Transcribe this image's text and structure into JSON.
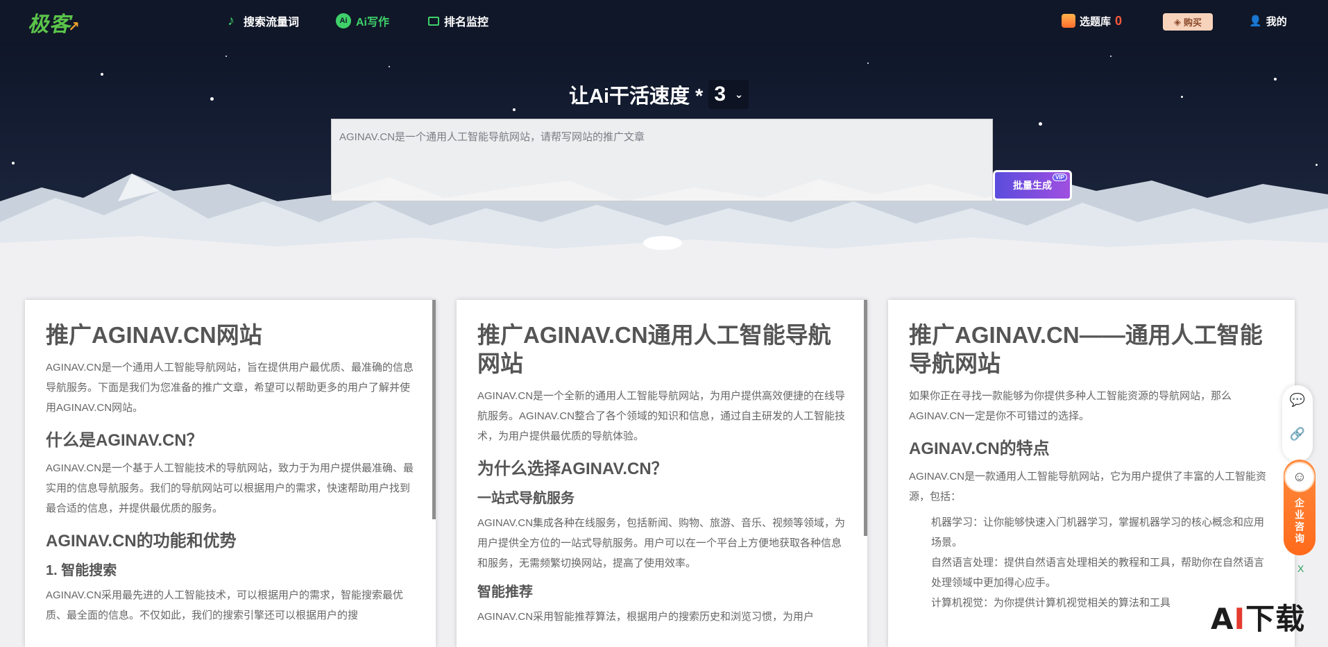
{
  "nav": {
    "logo": "极客",
    "items": [
      {
        "label": "搜索流量词",
        "icon": "tiktok-icon"
      },
      {
        "label": "Ai写作",
        "icon": "ai-icon",
        "icon_text": "Ai"
      },
      {
        "label": "排名监控",
        "icon": "monitor-icon"
      }
    ],
    "library_label": "选题库",
    "library_count": "0",
    "buy_label": "购买",
    "user_label": "我的"
  },
  "hero": {
    "title": "让Ai干活速度 *",
    "speed_value": "3",
    "prompt_text": "AGINAV.CN是一个通用人工智能导航网站，请帮写网站的推广文章",
    "generate_label": "批量生成",
    "vip_tag": "VIP"
  },
  "cards": [
    {
      "title": "推广AGINAV.CN网站",
      "intro": "AGINAV.CN是一个通用人工智能导航网站，旨在提供用户最优质、最准确的信息导航服务。下面是我们为您准备的推广文章，希望可以帮助更多的用户了解并使用AGINAV.CN网站。",
      "h2_a": "什么是AGINAV.CN？",
      "p_a": "AGINAV.CN是一个基于人工智能技术的导航网站，致力于为用户提供最准确、最实用的信息导航服务。我们的导航网站可以根据用户的需求，快速帮助用户找到最合适的信息，并提供最优质的服务。",
      "h2_b": "AGINAV.CN的功能和优势",
      "h3_a": "1. 智能搜索",
      "p_b": "AGINAV.CN采用最先进的人工智能技术，可以根据用户的需求，智能搜索最优质、最全面的信息。不仅如此，我们的搜索引擎还可以根据用户的搜"
    },
    {
      "title": "推广AGINAV.CN通用人工智能导航网站",
      "intro": "AGINAV.CN是一个全新的通用人工智能导航网站，为用户提供高效便捷的在线导航服务。AGINAV.CN整合了各个领域的知识和信息，通过自主研发的人工智能技术，为用户提供最优质的导航体验。",
      "h2_a": "为什么选择AGINAV.CN？",
      "h3_a": "一站式导航服务",
      "p_a": "AGINAV.CN集成各种在线服务，包括新闻、购物、旅游、音乐、视频等领域，为用户提供全方位的一站式导航服务。用户可以在一个平台上方便地获取各种信息和服务，无需频繁切换网站，提高了使用效率。",
      "h3_b": "智能推荐",
      "p_b": "AGINAV.CN采用智能推荐算法，根据用户的搜索历史和浏览习惯，为用户"
    },
    {
      "title": "推广AGINAV.CN——通用人工智能导航网站",
      "intro": "如果你正在寻找一款能够为你提供多种人工智能资源的导航网站，那么AGINAV.CN一定是你不可错过的选择。",
      "h2_a": "AGINAV.CN的特点",
      "p_a": "AGINAV.CN是一款通用人工智能导航网站，它为用户提供了丰富的人工智能资源，包括：",
      "list": [
        "机器学习：让你能够快速入门机器学习，掌握机器学习的核心概念和应用场景。",
        "自然语言处理：提供自然语言处理相关的教程和工具，帮助你在自然语言处理领域中更加得心应手。",
        "计算机视觉：为你提供计算机视觉相关的算法和工具"
      ]
    }
  ],
  "float": {
    "consult_label": "企业咨询",
    "close": "X"
  },
  "watermark": {
    "a": "A",
    "i": "I",
    "rest": "下载"
  }
}
